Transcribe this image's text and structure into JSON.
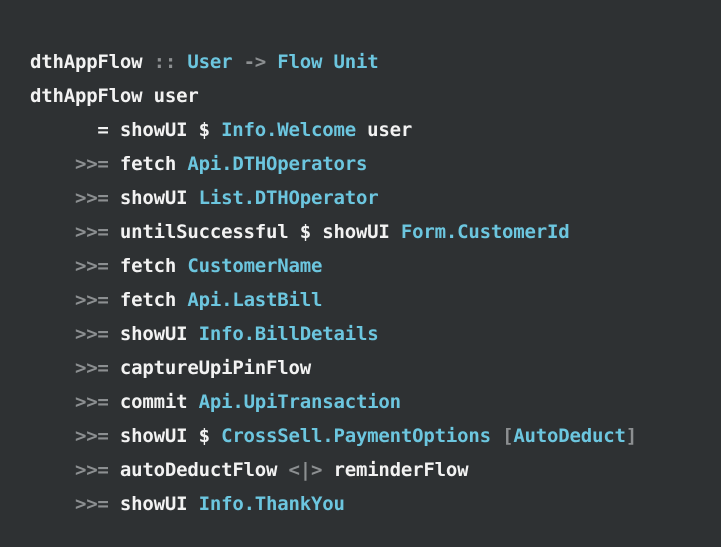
{
  "theme": {
    "background": "#2e3133",
    "identifier_color": "#f2f2f2",
    "type_color": "#6cc6df",
    "operator_color": "#8c8f91"
  },
  "code": {
    "lines": [
      {
        "tokens": [
          {
            "text": "dthAppFlow",
            "kind": "ident"
          },
          {
            "text": " :: ",
            "kind": "op"
          },
          {
            "text": "User",
            "kind": "type"
          },
          {
            "text": " -> ",
            "kind": "op"
          },
          {
            "text": "Flow",
            "kind": "type"
          },
          {
            "text": " ",
            "kind": "ident"
          },
          {
            "text": "Unit",
            "kind": "type"
          }
        ]
      },
      {
        "tokens": [
          {
            "text": "dthAppFlow user",
            "kind": "ident"
          }
        ]
      },
      {
        "tokens": [
          {
            "text": "      = showUI $ ",
            "kind": "ident"
          },
          {
            "text": "Info.Welcome",
            "kind": "type"
          },
          {
            "text": " user",
            "kind": "ident"
          }
        ]
      },
      {
        "tokens": [
          {
            "text": "    >>=",
            "kind": "op"
          },
          {
            "text": " fetch ",
            "kind": "ident"
          },
          {
            "text": "Api.DTHOperators",
            "kind": "type"
          }
        ]
      },
      {
        "tokens": [
          {
            "text": "    >>=",
            "kind": "op"
          },
          {
            "text": " showUI ",
            "kind": "ident"
          },
          {
            "text": "List.DTHOperator",
            "kind": "type"
          }
        ]
      },
      {
        "tokens": [
          {
            "text": "    >>=",
            "kind": "op"
          },
          {
            "text": " untilSuccessful $ showUI ",
            "kind": "ident"
          },
          {
            "text": "Form.CustomerId",
            "kind": "type"
          }
        ]
      },
      {
        "tokens": [
          {
            "text": "    >>=",
            "kind": "op"
          },
          {
            "text": " fetch ",
            "kind": "ident"
          },
          {
            "text": "CustomerName",
            "kind": "type"
          }
        ]
      },
      {
        "tokens": [
          {
            "text": "    >>=",
            "kind": "op"
          },
          {
            "text": " fetch ",
            "kind": "ident"
          },
          {
            "text": "Api.LastBill",
            "kind": "type"
          }
        ]
      },
      {
        "tokens": [
          {
            "text": "    >>=",
            "kind": "op"
          },
          {
            "text": " showUI ",
            "kind": "ident"
          },
          {
            "text": "Info.BillDetails",
            "kind": "type"
          }
        ]
      },
      {
        "tokens": [
          {
            "text": "    >>=",
            "kind": "op"
          },
          {
            "text": " captureUpiPinFlow",
            "kind": "ident"
          }
        ]
      },
      {
        "tokens": [
          {
            "text": "    >>=",
            "kind": "op"
          },
          {
            "text": " commit ",
            "kind": "ident"
          },
          {
            "text": "Api.UpiTransaction",
            "kind": "type"
          }
        ]
      },
      {
        "tokens": [
          {
            "text": "    >>=",
            "kind": "op"
          },
          {
            "text": " showUI $ ",
            "kind": "ident"
          },
          {
            "text": "CrossSell.PaymentOptions",
            "kind": "type"
          },
          {
            "text": " [",
            "kind": "op"
          },
          {
            "text": "AutoDeduct",
            "kind": "type"
          },
          {
            "text": "]",
            "kind": "op"
          }
        ]
      },
      {
        "tokens": [
          {
            "text": "    >>=",
            "kind": "op"
          },
          {
            "text": " autoDeductFlow ",
            "kind": "ident"
          },
          {
            "text": "<|>",
            "kind": "op"
          },
          {
            "text": " reminderFlow",
            "kind": "ident"
          }
        ]
      },
      {
        "tokens": [
          {
            "text": "    >>=",
            "kind": "op"
          },
          {
            "text": " showUI ",
            "kind": "ident"
          },
          {
            "text": "Info.ThankYou",
            "kind": "type"
          }
        ]
      }
    ]
  }
}
